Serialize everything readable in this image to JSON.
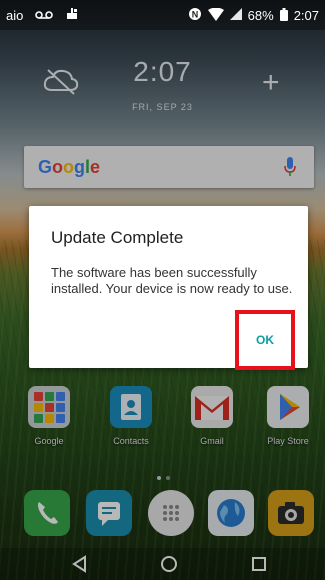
{
  "status_bar": {
    "carrier": "aio",
    "battery_percent": "68%",
    "time": "2:07",
    "icons": [
      "voicemail-icon",
      "usb-icon",
      "nfc-icon",
      "wifi-icon",
      "signal-icon",
      "battery-icon"
    ]
  },
  "clock_widget": {
    "time": "2:07",
    "date": "FRI, SEP 23",
    "weather_icon": "cloud-off-icon",
    "add_icon": "plus-icon"
  },
  "search_bar": {
    "logo": "Google",
    "mic_icon": "mic-icon"
  },
  "dialog": {
    "title": "Update Complete",
    "message": "The software has been successfully installed. Your device is now ready to use.",
    "ok_label": "OK",
    "ok_color": "#0b9ea4",
    "highlight_color": "#e8101a"
  },
  "apps": [
    {
      "label": "Google",
      "icon": "google-folder-icon"
    },
    {
      "label": "Contacts",
      "icon": "contacts-icon"
    },
    {
      "label": "Gmail",
      "icon": "gmail-icon"
    },
    {
      "label": "Play Store",
      "icon": "play-store-icon"
    }
  ],
  "dock": [
    {
      "icon": "phone-icon",
      "color": "#3aa84c"
    },
    {
      "icon": "messages-icon",
      "color": "#1b8fb0"
    },
    {
      "icon": "app-drawer-icon",
      "color": "#e9e9e9"
    },
    {
      "icon": "browser-icon",
      "color": "#2a7fd0"
    },
    {
      "icon": "camera-icon",
      "color": "#d9a21a"
    }
  ],
  "nav_bar": {
    "back_icon": "back-icon",
    "home_icon": "home-icon",
    "recents_icon": "recents-icon"
  }
}
